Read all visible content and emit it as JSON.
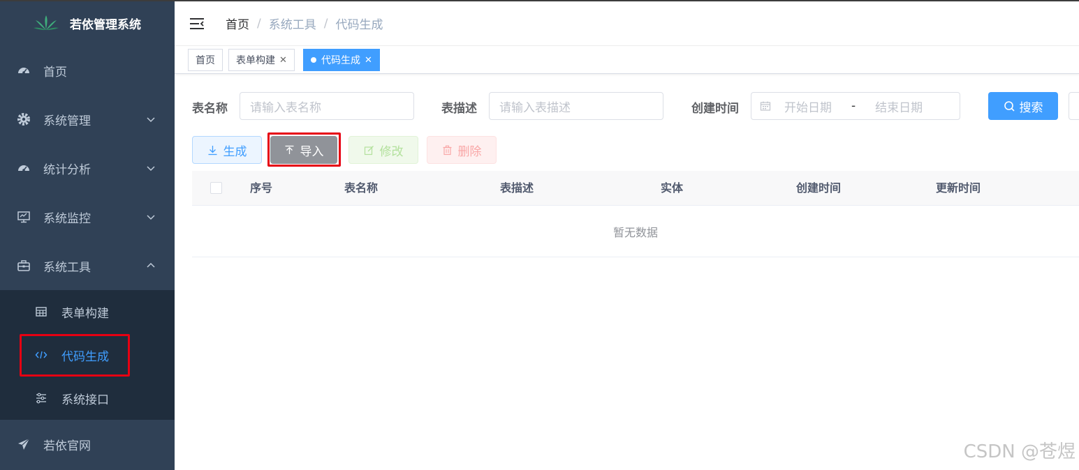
{
  "app": {
    "title": "若依管理系统"
  },
  "sidebar": {
    "items": [
      {
        "label": "首页",
        "icon": "dashboard-icon"
      },
      {
        "label": "系统管理",
        "icon": "gear-icon"
      },
      {
        "label": "统计分析",
        "icon": "dashboard-icon"
      },
      {
        "label": "系统监控",
        "icon": "monitor-icon"
      },
      {
        "label": "系统工具",
        "icon": "toolbox-icon"
      }
    ],
    "tools_submenu": [
      {
        "label": "表单构建",
        "icon": "table-icon"
      },
      {
        "label": "代码生成",
        "icon": "code-icon",
        "active": true
      },
      {
        "label": "系统接口",
        "icon": "sliders-icon"
      }
    ],
    "footer_item": {
      "label": "若依官网",
      "icon": "paper-plane-icon"
    }
  },
  "breadcrumb": {
    "items": [
      "首页",
      "系统工具",
      "代码生成"
    ]
  },
  "tags": [
    {
      "label": "首页"
    },
    {
      "label": "表单构建"
    },
    {
      "label": "代码生成",
      "active": true
    }
  ],
  "search": {
    "table_name": {
      "label": "表名称",
      "placeholder": "请输入表名称"
    },
    "table_desc": {
      "label": "表描述",
      "placeholder": "请输入表描述"
    },
    "created_time": {
      "label": "创建时间",
      "start_placeholder": "开始日期",
      "separator": "-",
      "end_placeholder": "结束日期"
    },
    "search_button": "搜索"
  },
  "actions": {
    "generate": "生成",
    "import": "导入",
    "edit": "修改",
    "delete": "删除"
  },
  "table": {
    "columns": [
      "序号",
      "表名称",
      "表描述",
      "实体",
      "创建时间",
      "更新时间"
    ],
    "empty_text": "暂无数据"
  },
  "watermark": "CSDN @苍煜",
  "colors": {
    "sidebar_bg": "#304156",
    "submenu_bg": "#1f2d3d",
    "primary": "#409eff",
    "highlight": "#e60012"
  }
}
